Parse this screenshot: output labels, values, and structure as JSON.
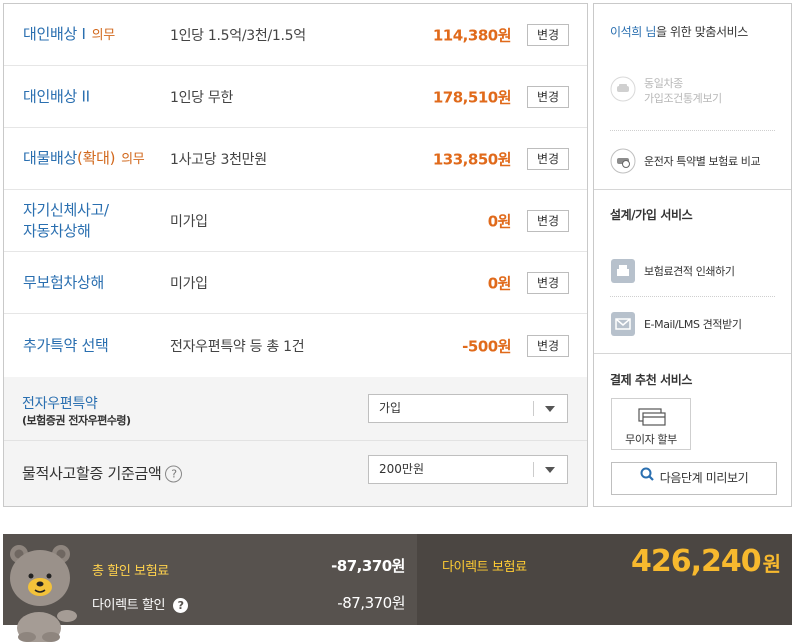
{
  "coverages": [
    {
      "title": "대인배상 I",
      "title_accent": "",
      "mandatory": "의무",
      "desc": "1인당 1.5억/3천/1.5억",
      "amount": "114,380원",
      "button": "변경"
    },
    {
      "title": "대인배상 II",
      "title_accent": "",
      "mandatory": "",
      "desc": "1인당 무한",
      "amount": "178,510원",
      "button": "변경"
    },
    {
      "title": "대물배상",
      "title_accent": "(확대)",
      "mandatory": "의무",
      "desc": "1사고당 3천만원",
      "amount": "133,850원",
      "button": "변경"
    },
    {
      "title_line1": "자기신체사고/",
      "title_line2": "자동차상해",
      "desc": "미가입",
      "amount": "0원",
      "button": "변경"
    },
    {
      "title": "무보험차상해",
      "title_accent": "",
      "mandatory": "",
      "desc": "미가입",
      "amount": "0원",
      "button": "변경"
    },
    {
      "title": "추가특약 선택",
      "title_accent": "",
      "mandatory": "",
      "desc": "전자우편특약 등 총 1건",
      "amount": "-500원",
      "button": "변경"
    }
  ],
  "email_option": {
    "title": "전자우편특약",
    "subtitle": "(보험증권 전자우편수령)",
    "selected": "가입"
  },
  "property_threshold": {
    "title": "물적사고할증 기준금액",
    "help": "?",
    "selected": "200만원"
  },
  "sidebar": {
    "custom_name": "이석희 님",
    "custom_suffix": "을 위한 맞춤서비스",
    "same_car_line1": "동일차종",
    "same_car_line2": "가입조건통계보기",
    "driver_compare": "운전자 특약별 보험료 비교",
    "design_title": "설계/가입 서비스",
    "print_quote": "보험료견적 인쇄하기",
    "email_quote": "E-Mail/LMS 견적받기",
    "payment_title": "결제 추천 서비스",
    "installment": "무이자 할부",
    "preview": "다음단계 미리보기"
  },
  "summary": {
    "total_discount_label": "총 할인 보험료",
    "total_discount_value": "-87,370원",
    "direct_discount_label": "다이렉트 할인",
    "direct_discount_help": "?",
    "direct_discount_value": "-87,370원",
    "direct_premium_label": "다이렉트 보험료",
    "direct_premium_value": "426,240",
    "direct_premium_unit": "원"
  },
  "colors": {
    "title_blue": "#2a6fb0",
    "amount_orange": "#e06a1b",
    "summary_bg": "#57524e",
    "premium_gold": "#f7b92e"
  }
}
